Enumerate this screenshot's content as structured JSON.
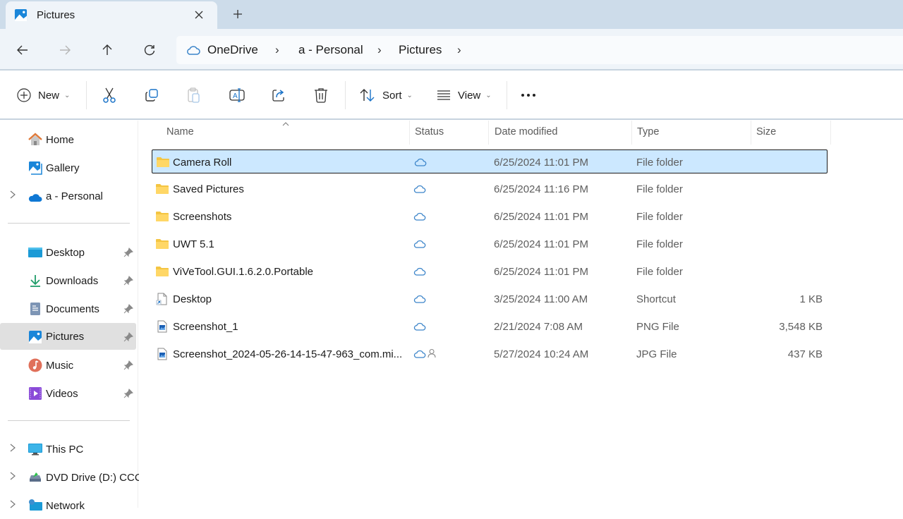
{
  "window": {
    "tab_title": "Pictures",
    "tab_icon": "pictures-folder-icon",
    "close_tab_icon": "close-icon",
    "new_tab_icon": "plus-icon"
  },
  "nav": {
    "back_icon": "arrow-left-icon",
    "forward_icon": "arrow-right-icon",
    "up_icon": "arrow-up-icon",
    "refresh_icon": "refresh-icon",
    "breadcrumb": [
      {
        "label": "OneDrive",
        "icon": "cloud-icon"
      },
      {
        "label": "a - Personal"
      },
      {
        "label": "Pictures"
      }
    ],
    "separator": "›"
  },
  "toolbar": {
    "new_label": "New",
    "sort_label": "Sort",
    "view_label": "View",
    "more_label": "•••",
    "chevron": "⌄",
    "icons": {
      "new": "plus-circle-icon",
      "cut": "scissors-icon",
      "copy": "copy-icon",
      "paste": "paste-icon",
      "rename": "rename-icon",
      "share": "share-icon",
      "delete": "trash-icon",
      "sort": "sort-icon",
      "view": "view-list-icon",
      "more": "more-icon"
    }
  },
  "sidebar": {
    "quick": [
      {
        "label": "Home",
        "icon": "home-icon"
      },
      {
        "label": "Gallery",
        "icon": "gallery-icon"
      },
      {
        "label": "a - Personal",
        "icon": "onedrive-icon",
        "expandable": true
      }
    ],
    "pinned": [
      {
        "label": "Desktop",
        "icon": "desktop-folder-icon",
        "pinned": true
      },
      {
        "label": "Downloads",
        "icon": "download-icon",
        "pinned": true
      },
      {
        "label": "Documents",
        "icon": "documents-icon",
        "pinned": true
      },
      {
        "label": "Pictures",
        "icon": "pictures-icon",
        "pinned": true,
        "selected": true
      },
      {
        "label": "Music",
        "icon": "music-icon",
        "pinned": true
      },
      {
        "label": "Videos",
        "icon": "videos-icon",
        "pinned": true
      }
    ],
    "devices": [
      {
        "label": "This PC",
        "icon": "computer-icon",
        "expandable": true
      },
      {
        "label": "DVD Drive (D:) CCC",
        "icon": "dvd-drive-icon",
        "expandable": true
      },
      {
        "label": "Network",
        "icon": "network-icon",
        "expandable": true
      }
    ]
  },
  "table": {
    "columns": [
      "Name",
      "Status",
      "Date modified",
      "Type",
      "Size"
    ],
    "sort_indicator": "^",
    "rows": [
      {
        "name": "Camera Roll",
        "icon": "folder-icon",
        "status": "cloud",
        "date": "6/25/2024 11:01 PM",
        "type": "File folder",
        "size": "",
        "selected": true
      },
      {
        "name": "Saved Pictures",
        "icon": "folder-icon",
        "status": "cloud",
        "date": "6/25/2024 11:16 PM",
        "type": "File folder",
        "size": ""
      },
      {
        "name": "Screenshots",
        "icon": "folder-icon",
        "status": "cloud",
        "date": "6/25/2024 11:01 PM",
        "type": "File folder",
        "size": ""
      },
      {
        "name": "UWT 5.1",
        "icon": "folder-icon",
        "status": "cloud",
        "date": "6/25/2024 11:01 PM",
        "type": "File folder",
        "size": ""
      },
      {
        "name": "ViVeTool.GUI.1.6.2.0.Portable",
        "icon": "folder-icon",
        "status": "cloud",
        "date": "6/25/2024 11:01 PM",
        "type": "File folder",
        "size": ""
      },
      {
        "name": "Desktop",
        "icon": "shortcut-icon",
        "status": "cloud",
        "date": "3/25/2024 11:00 AM",
        "type": "Shortcut",
        "size": "1 KB"
      },
      {
        "name": "Screenshot_1",
        "icon": "image-file-icon",
        "status": "cloud",
        "date": "2/21/2024 7:08 AM",
        "type": "PNG File",
        "size": "3,548 KB"
      },
      {
        "name": "Screenshot_2024-05-26-14-15-47-963_com.mi...",
        "icon": "image-file-icon",
        "status": "cloud-shared",
        "date": "5/27/2024 10:24 AM",
        "type": "JPG File",
        "size": "437 KB"
      }
    ]
  },
  "colors": {
    "accent": "#0f6cbd",
    "selection_bg": "#cce8ff",
    "titlebar_bg": "#cddcea",
    "nav_bg": "#eff4f9",
    "folder_yellow": "#f4c542"
  }
}
